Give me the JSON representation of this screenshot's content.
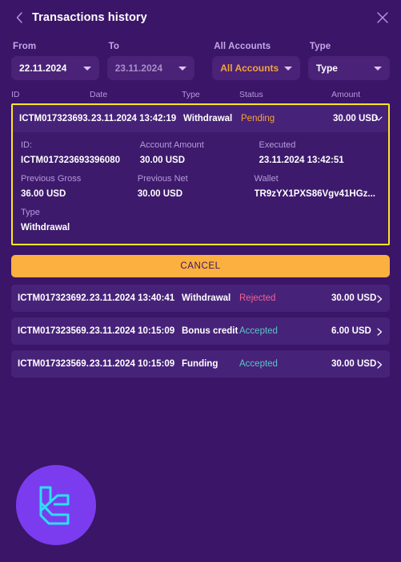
{
  "header": {
    "title": "Transactions history",
    "back_icon": "chevron-left-icon",
    "close_icon": "close-icon"
  },
  "filters": {
    "from": {
      "label": "From",
      "value": "22.11.2024"
    },
    "to": {
      "label": "To",
      "value": "23.11.2024"
    },
    "account": {
      "label": "All Accounts",
      "value": "All Accounts"
    },
    "type": {
      "label": "Type",
      "value": "Type"
    }
  },
  "table": {
    "columns": {
      "id": "ID",
      "date": "Date",
      "type": "Type",
      "status": "Status",
      "amount": "Amount"
    },
    "selected_row": {
      "id": "ICTM017323693...",
      "date": "23.11.2024 13:42:19",
      "type": "Withdrawal",
      "status": "Pending",
      "amount": "30.00 USD",
      "expander_icon": "chevron-down-icon",
      "details": {
        "id_label": "ID:",
        "id_value": "ICTM017323693396080",
        "account_amount_label": "Account Amount",
        "account_amount_value": "30.00 USD",
        "executed_label": "Executed",
        "executed_value": "23.11.2024 13:42:51",
        "previous_gross_label": "Previous Gross",
        "previous_gross_value": "36.00 USD",
        "previous_net_label": "Previous Net",
        "previous_net_value": "30.00 USD",
        "wallet_label": "Wallet",
        "wallet_value": "TR9zYX1PXS86Vgv41HGz...",
        "type_label": "Type",
        "type_value": "Withdrawal"
      }
    },
    "cancel_button": "CANCEL",
    "rows": [
      {
        "id": "ICTM017323692...",
        "date": "23.11.2024 13:40:41",
        "type": "Withdrawal",
        "status": "Rejected",
        "status_kind": "rejected",
        "amount": "30.00 USD"
      },
      {
        "id": "ICTM017323569...",
        "date": "23.11.2024 10:15:09",
        "type": "Bonus credit",
        "status": "Accepted",
        "status_kind": "accepted",
        "amount": "6.00 USD"
      },
      {
        "id": "ICTM017323569...",
        "date": "23.11.2024 10:15:09",
        "type": "Funding",
        "status": "Accepted",
        "status_kind": "accepted",
        "amount": "30.00 USD"
      }
    ]
  },
  "branding": {
    "logo_icon": "brand-monogram-logo"
  },
  "colors": {
    "background": "#3a1568",
    "row": "#472279",
    "accent_orange": "#f2a33c",
    "cancel_button": "#fbb040",
    "highlight_border": "#ffe51f",
    "status_rejected": "#f06292",
    "status_accepted": "#59c6c6",
    "logo_circle": "#7b3cf0",
    "logo_mark": "#2ae0f5"
  }
}
